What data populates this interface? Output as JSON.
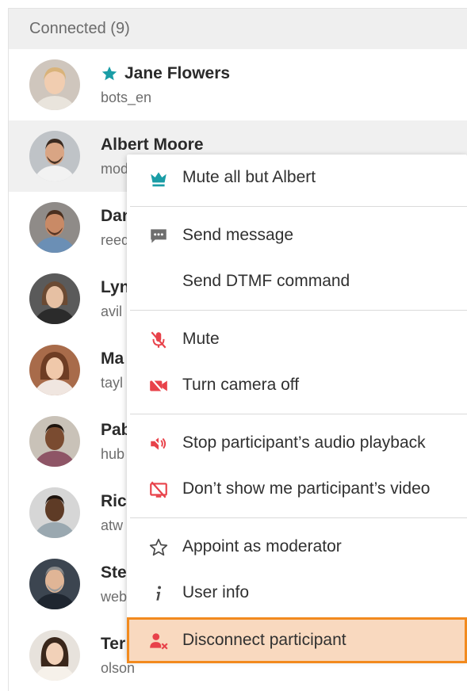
{
  "header": {
    "title": "Connected (9)"
  },
  "participants": [
    {
      "name": "Jane Flowers",
      "sub": "bots_en",
      "moderator": true
    },
    {
      "name": "Albert Moore",
      "sub": "mod"
    },
    {
      "name": "Dan",
      "sub": "reed"
    },
    {
      "name": "Lyn",
      "sub": "avil"
    },
    {
      "name": "Ma",
      "sub": "tayl"
    },
    {
      "name": "Pab",
      "sub": "hub"
    },
    {
      "name": "Ric",
      "sub": "atw"
    },
    {
      "name": "Ste",
      "sub": "web"
    },
    {
      "name": "Ter",
      "sub": "olson"
    }
  ],
  "menu": {
    "items": [
      {
        "label": "Mute all but Albert",
        "icon": "crown-icon"
      },
      {
        "label": "Send message",
        "icon": "chat-icon"
      },
      {
        "label": "Send DTMF command",
        "icon": ""
      },
      {
        "label": "Mute",
        "icon": "mic-off-icon"
      },
      {
        "label": "Turn camera off",
        "icon": "camera-off-icon"
      },
      {
        "label": "Stop participant’s audio playback",
        "icon": "speaker-off-icon"
      },
      {
        "label": "Don’t show me participant’s video",
        "icon": "screen-off-icon"
      },
      {
        "label": "Appoint as moderator",
        "icon": "star-outline-icon"
      },
      {
        "label": "User info",
        "icon": "info-icon"
      },
      {
        "label": "Disconnect participant",
        "icon": "user-remove-icon"
      }
    ]
  },
  "colors": {
    "accent_teal": "#1a9da6",
    "danger_red": "#e8424a",
    "highlight_bg": "#f9d9bf",
    "highlight_border": "#f28a1e"
  }
}
